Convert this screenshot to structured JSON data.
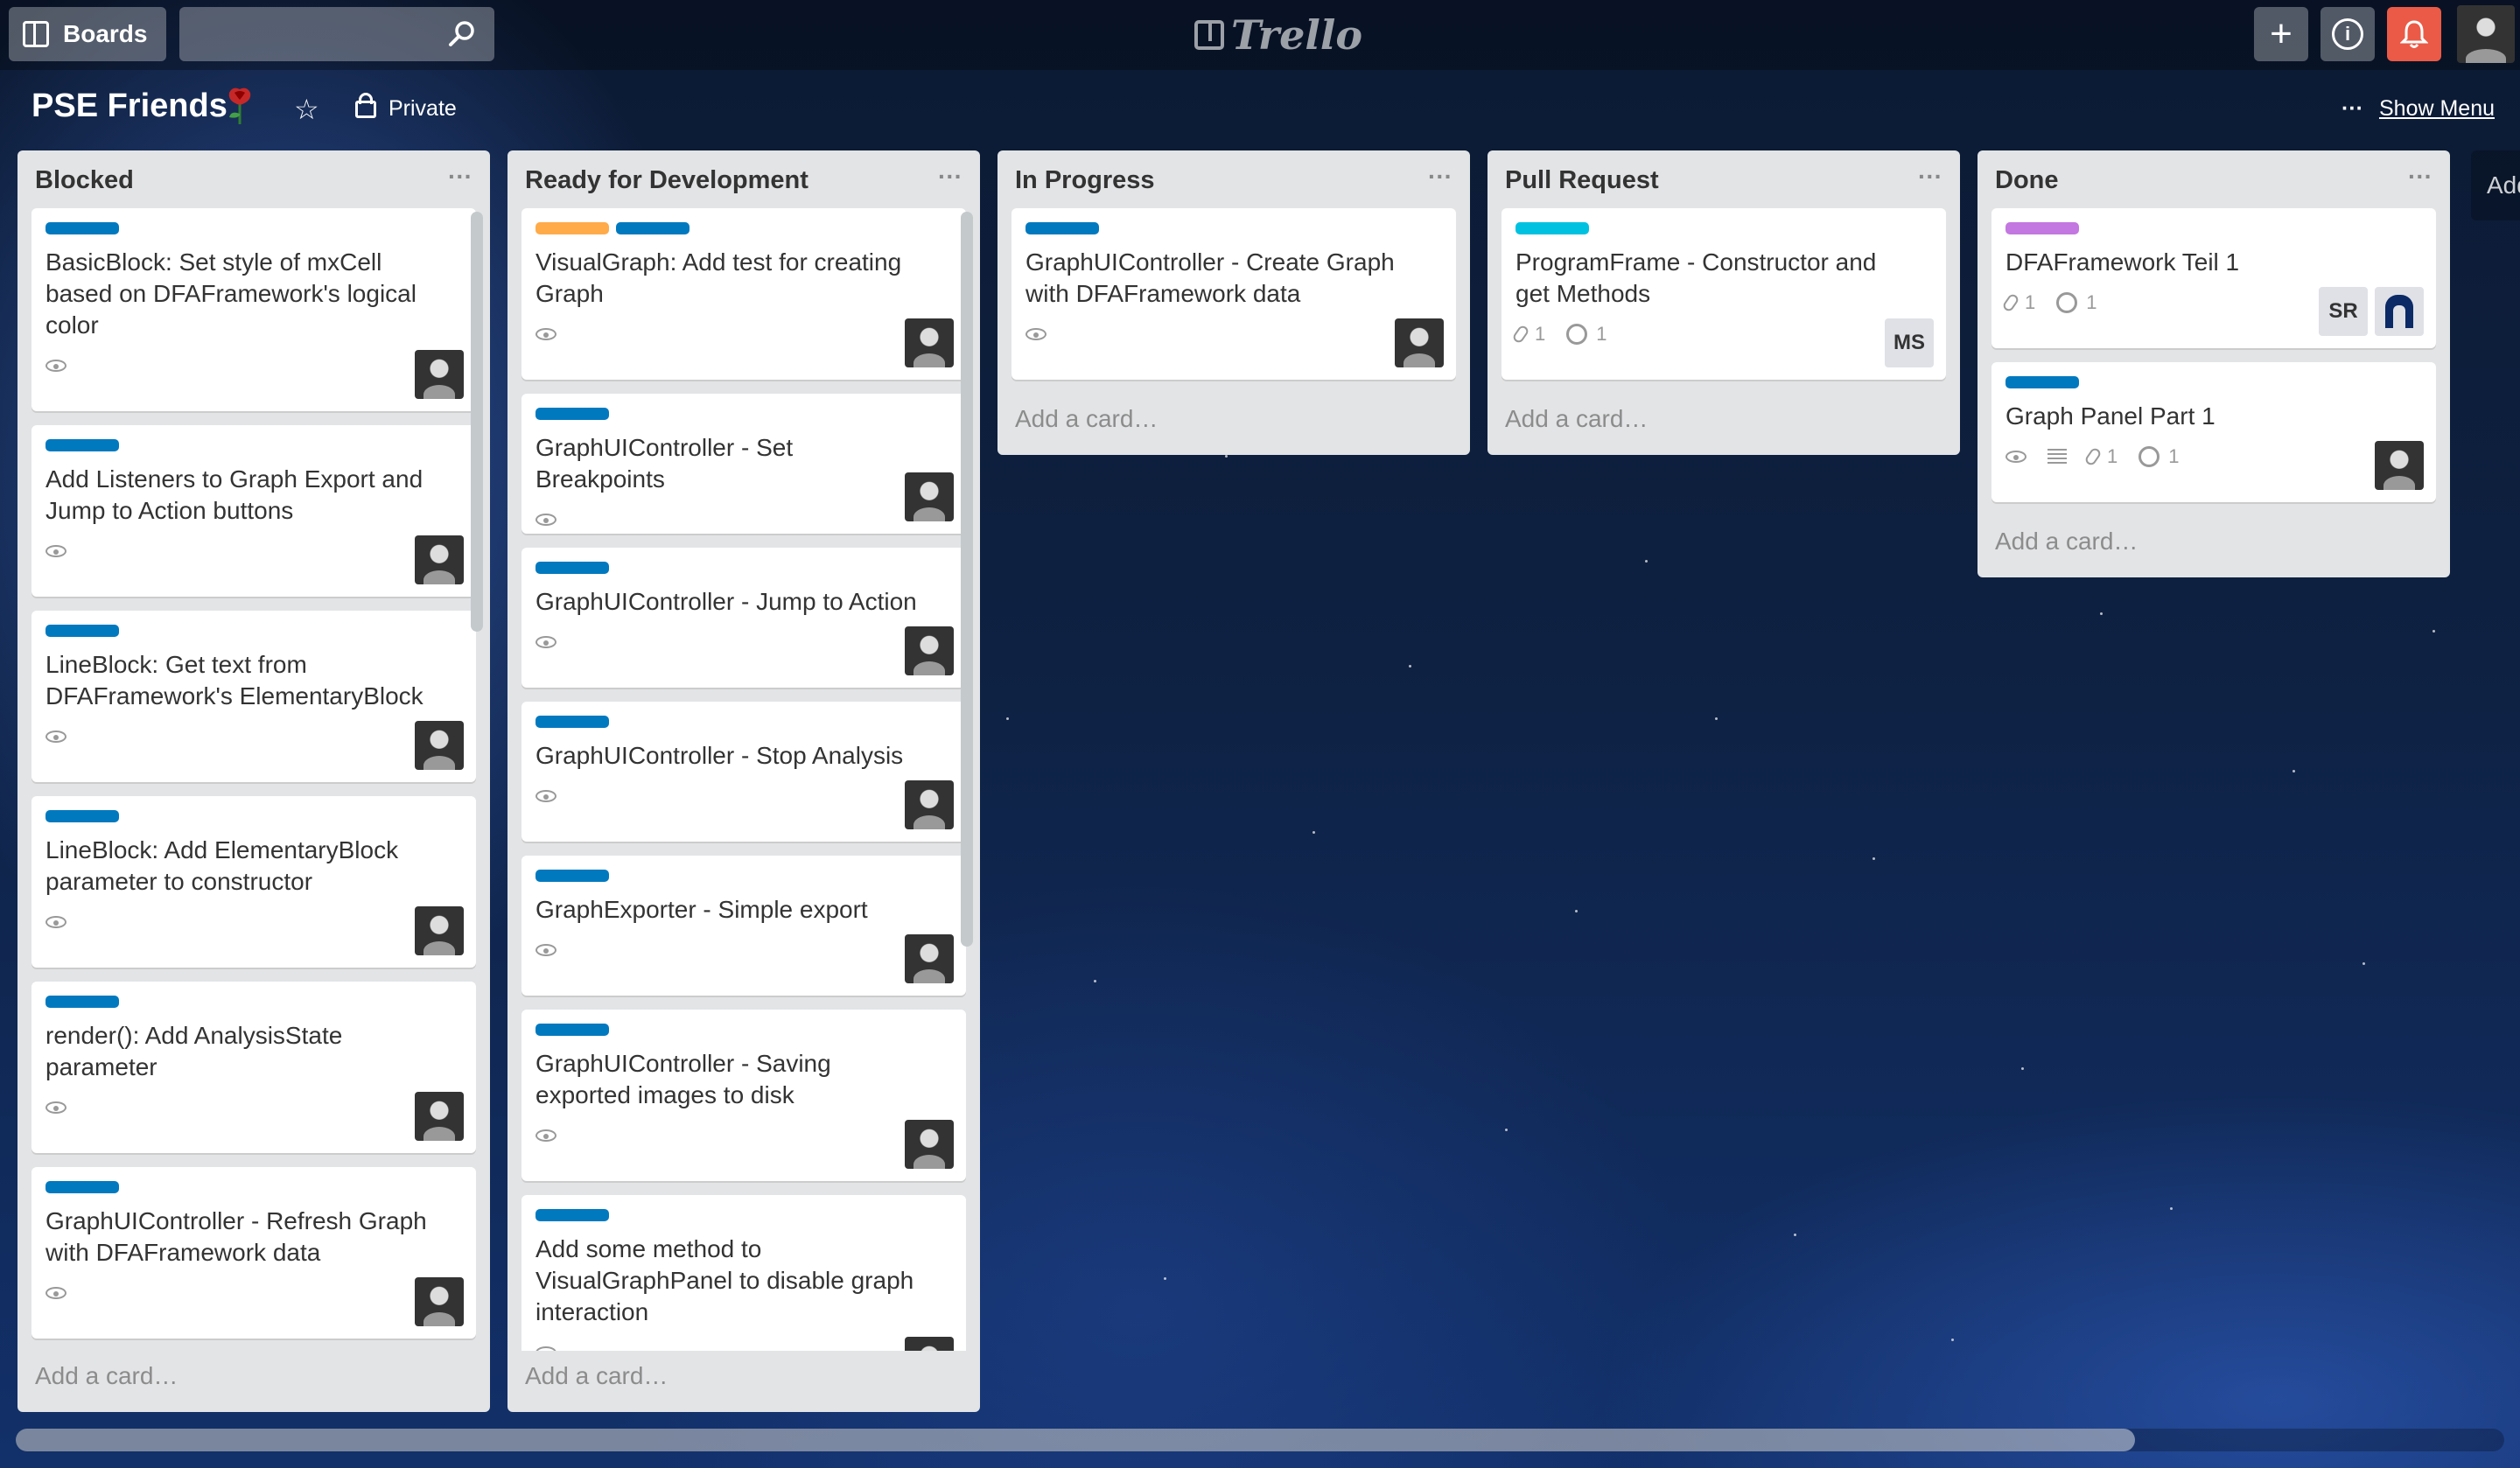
{
  "header": {
    "boards_label": "Boards",
    "search_placeholder": "",
    "logo_text": "Trello",
    "add_symbol": "+",
    "info_symbol": "i"
  },
  "board": {
    "title": "PSE Friends",
    "visibility": "Private",
    "show_menu_dots": "···",
    "show_menu_label": "Show Menu"
  },
  "add_list_label": "Add",
  "colors": {
    "blue": "#0079bf",
    "orange": "#ffab4a",
    "sky": "#00c2e0",
    "purple": "#c377e0",
    "notify": "#eb5a46"
  },
  "lists": [
    {
      "title": "Blocked",
      "add_card": "Add a card…",
      "cards": [
        {
          "title": "BasicBlock: Set style of mxCell based on DFAFramework's logical color"
        },
        {
          "title": "Add Listeners to Graph Export and Jump to Action buttons"
        },
        {
          "title": "LineBlock: Get text from DFAFramework's ElementaryBlock"
        },
        {
          "title": "LineBlock: Add ElementaryBlock parameter to constructor"
        },
        {
          "title": "render(): Add AnalysisState parameter"
        },
        {
          "title": "GraphUIController - Refresh Graph with DFAFramework data"
        }
      ]
    },
    {
      "title": "Ready for Development",
      "add_card": "Add a card…",
      "cards": [
        {
          "title": "VisualGraph: Add test for creating Graph"
        },
        {
          "title": "GraphUIController - Set Breakpoints"
        },
        {
          "title": "GraphUIController - Jump to Action"
        },
        {
          "title": "GraphUIController - Stop Analysis"
        },
        {
          "title": "GraphExporter - Simple export"
        },
        {
          "title": "GraphUIController - Saving exported images to disk"
        },
        {
          "title": "Add some method to VisualGraphPanel to disable graph interaction"
        }
      ]
    },
    {
      "title": "In Progress",
      "add_card": "Add a card…",
      "cards": [
        {
          "title": "GraphUIController - Create Graph with DFAFramework data"
        }
      ]
    },
    {
      "title": "Pull Request",
      "add_card": "Add a card…",
      "cards": [
        {
          "title": "ProgramFrame - Constructor and get Methods",
          "attachments": "1",
          "github": "1",
          "member": "MS"
        }
      ]
    },
    {
      "title": "Done",
      "add_card": "Add a card…",
      "cards": [
        {
          "title": "DFAFramework Teil 1",
          "attachments": "1",
          "github": "1",
          "member": "SR"
        },
        {
          "title": "Graph Panel Part 1",
          "attachments": "1",
          "github": "1"
        }
      ]
    }
  ],
  "list_menu": "···"
}
